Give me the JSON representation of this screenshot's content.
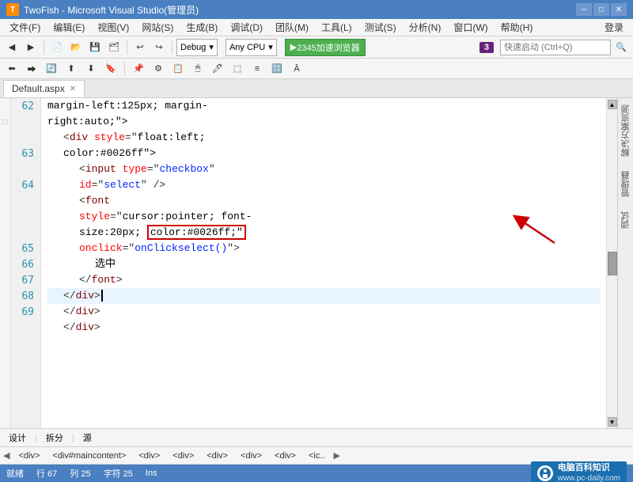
{
  "app": {
    "title": "TwoFish - Microsoft Visual Studio(管理员)",
    "vs_version": "3",
    "icon_label": "T"
  },
  "menu": {
    "items": [
      "文件(F)",
      "编辑(E)",
      "视图(V)",
      "网站(S)",
      "生成(B)",
      "调试(D)",
      "团队(M)",
      "工具(L)",
      "测试(S)",
      "分析(N)",
      "窗口(W)",
      "帮助(H)",
      "登录"
    ]
  },
  "toolbar": {
    "debug_label": "Debug",
    "cpu_label": "Any CPU",
    "browser_label": "2345加速浏览器",
    "search_placeholder": "快速启动 (Ctrl+Q)"
  },
  "tab": {
    "name": "Default.aspx",
    "modified": false
  },
  "code": {
    "lines": [
      {
        "num": "62",
        "content": "margin-left:125px; margin-right:auto;\">",
        "indent": 0
      },
      {
        "num": "",
        "content": "    <div style=\"float:left;",
        "indent": 0
      },
      {
        "num": "",
        "content": "color:#0026ff\">",
        "indent": 0
      },
      {
        "num": "63",
        "content": "        <input type=\"checkbox\"",
        "indent": 0
      },
      {
        "num": "",
        "content": "id=\"select\" />",
        "indent": 0
      },
      {
        "num": "64",
        "content": "        <font",
        "indent": 0
      },
      {
        "num": "",
        "content": "style=\"cursor:pointer; font-",
        "indent": 0
      },
      {
        "num": "",
        "content": "size:20px; color:#0026ff;\"",
        "indent": 0
      },
      {
        "num": "",
        "content": "onclick=\"onClickselect()\">",
        "indent": 0
      },
      {
        "num": "65",
        "content": "            选中",
        "indent": 0
      },
      {
        "num": "66",
        "content": "        </font>",
        "indent": 0
      },
      {
        "num": "67",
        "content": "    </div>|",
        "indent": 0
      },
      {
        "num": "68",
        "content": "    </div>",
        "indent": 0
      },
      {
        "num": "69",
        "content": "    </div>",
        "indent": 0
      }
    ]
  },
  "bottom_toolbar": {
    "design": "设计",
    "split": "拆分",
    "source": "源"
  },
  "breadcrumbs": [
    "<div>",
    "<div#maincontent>",
    "<div>",
    "<div>",
    "<div>",
    "<div>",
    "<div>",
    "<ic.."
  ],
  "status": {
    "ready": "就绪",
    "row": "行 67",
    "col": "列 25",
    "char": "字符 25",
    "ins": "Ins"
  },
  "watermark": {
    "site": "www.pc-daily.com",
    "label": "电脑百科知识"
  },
  "right_panel": {
    "items": [
      "解",
      "决",
      "方",
      "案",
      "资",
      "源",
      "管",
      "理"
    ]
  },
  "highlighted_text": "color:#0026ff;\""
}
